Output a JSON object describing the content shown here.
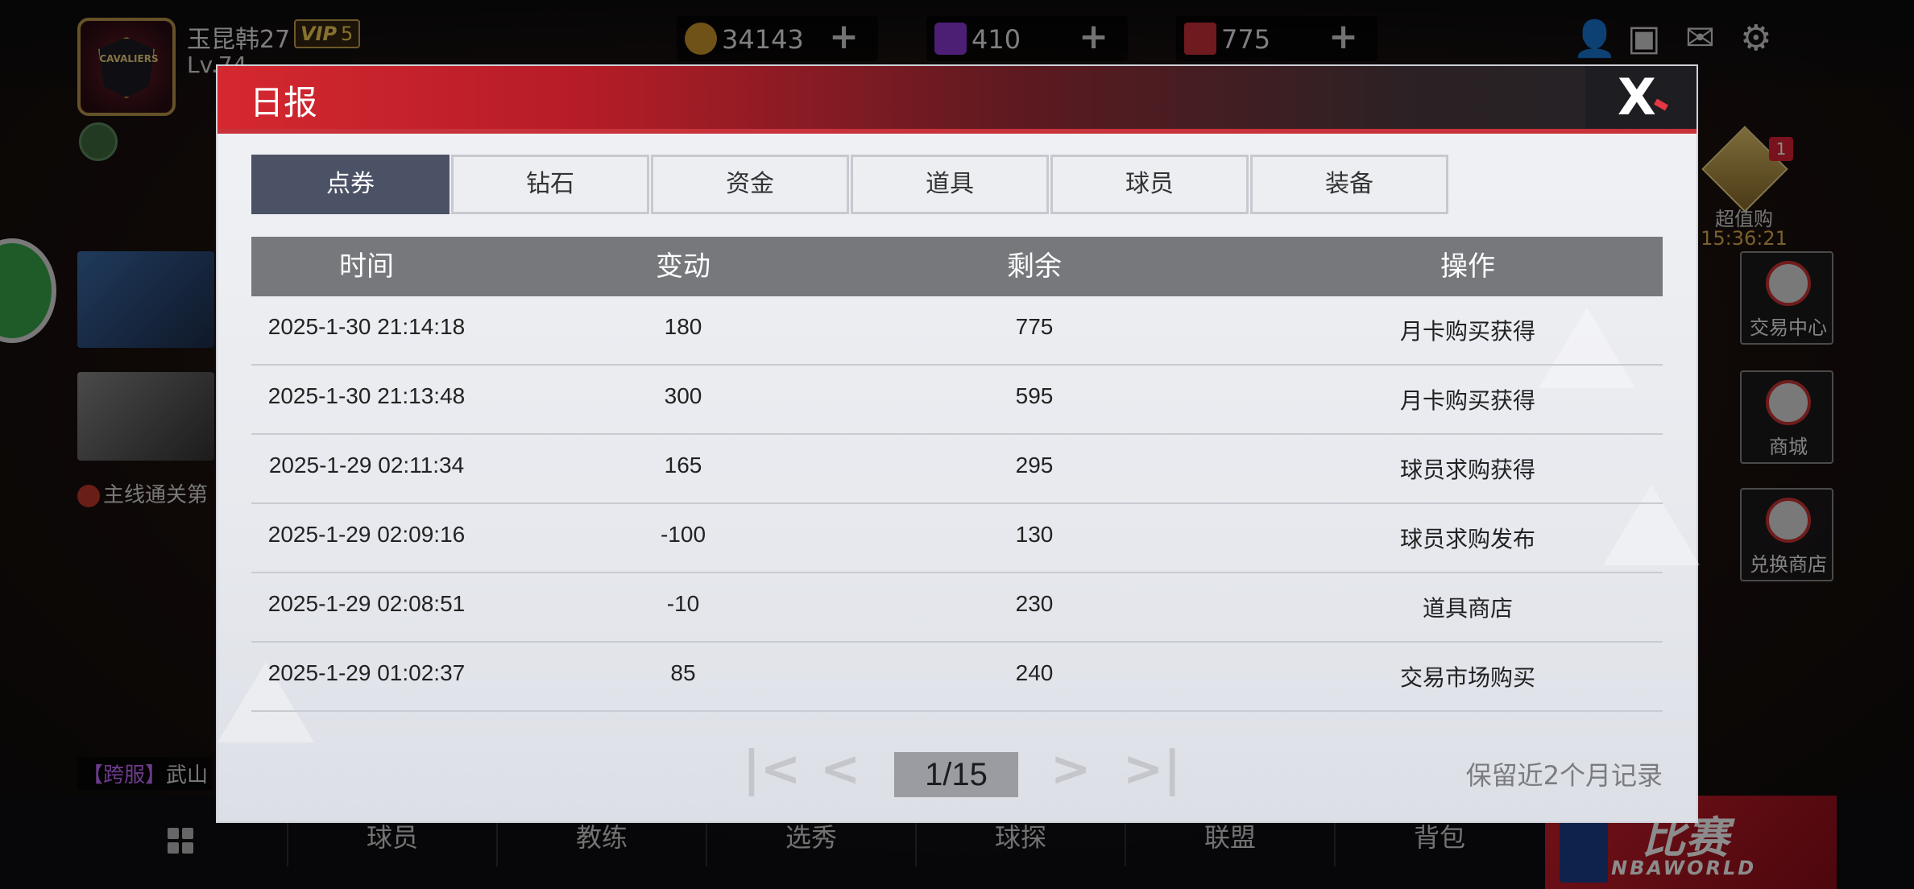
{
  "hud": {
    "player_name": "玉昆韩27",
    "vip_word": "VIP",
    "vip_level": "5",
    "player_level": "Lv.74",
    "avatar_text": "CAVALIERS",
    "currencies": [
      {
        "icon": "coin-icon",
        "value": "34143",
        "color": "#c8962a"
      },
      {
        "icon": "diamond-icon",
        "value": "410",
        "color": "#8a3ad6"
      },
      {
        "icon": "ticket-icon",
        "value": "775",
        "color": "#c9303a"
      }
    ],
    "plus": "+",
    "mission_text": "主线通关第",
    "cross_server_tag": "【跨服】",
    "cross_server_text": "武山",
    "promo_badge": "1",
    "promo_label": "超值购",
    "promo_timer": "15:36:21",
    "side_buttons": [
      "交易中心",
      "商城",
      "兑换商店"
    ]
  },
  "bottom_nav": {
    "items": [
      "球员",
      "教练",
      "选秀",
      "球探",
      "联盟",
      "背包"
    ],
    "match_label": "比赛",
    "match_sub": "NBAWORLD"
  },
  "modal": {
    "title": "日报",
    "close_glyph": "X",
    "tabs": [
      "点券",
      "钻石",
      "资金",
      "道具",
      "球员",
      "装备"
    ],
    "active_tab": 0,
    "columns": [
      "时间",
      "变动",
      "剩余",
      "操作"
    ],
    "rows": [
      [
        "2025-1-30 21:14:18",
        "180",
        "775",
        "月卡购买获得"
      ],
      [
        "2025-1-30 21:13:48",
        "300",
        "595",
        "月卡购买获得"
      ],
      [
        "2025-1-29 02:11:34",
        "165",
        "295",
        "球员求购获得"
      ],
      [
        "2025-1-29 02:09:16",
        "-100",
        "130",
        "球员求购发布"
      ],
      [
        "2025-1-29 02:08:51",
        "-10",
        "230",
        "道具商店"
      ],
      [
        "2025-1-29 01:02:37",
        "85",
        "240",
        "交易市场购买"
      ]
    ],
    "pager": {
      "first": "|<",
      "prev": "<",
      "page": "1/15",
      "next": ">",
      "last": ">|"
    },
    "retention_note": "保留近2个月记录"
  }
}
